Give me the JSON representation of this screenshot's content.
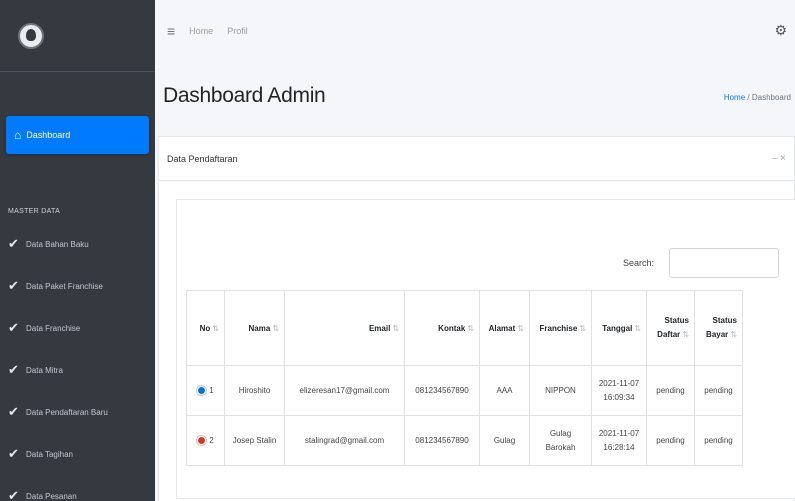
{
  "brand": {
    "line1": "",
    "line2": ""
  },
  "sidebar": {
    "active_item": {
      "label": "Dashboard",
      "icon": "home-icon"
    },
    "section_header": "MASTER DATA",
    "items": [
      {
        "label": "Data Bahan Baku",
        "icon": "check-icon"
      },
      {
        "label": "Data Paket Franchise",
        "icon": "check-icon"
      },
      {
        "label": "Data Franchise",
        "icon": "check-icon"
      },
      {
        "label": "Data Mitra",
        "icon": "check-icon"
      },
      {
        "label": "Data Pendaftaran Baru",
        "icon": "check-icon"
      },
      {
        "label": "Data Tagihan",
        "icon": "check-icon"
      },
      {
        "label": "Data Pesanan",
        "icon": "check-icon"
      }
    ]
  },
  "topbar": {
    "links": [
      "Home",
      "Profil"
    ]
  },
  "page": {
    "title": "Dashboard Admin",
    "breadcrumb": {
      "home": "Home",
      "separator": "/",
      "current": "Dashboard"
    }
  },
  "card": {
    "title": "Data Pendaftaran",
    "tools": "– ×"
  },
  "table": {
    "search_label": "Search:",
    "search_value": "",
    "headers": [
      "No",
      "Nama",
      "Email",
      "Kontak",
      "Alamat",
      "Franchise",
      "Tanggal",
      "Status Daftar",
      "Status Bayar"
    ],
    "rows": [
      {
        "no": "1",
        "nama": "Hiroshito",
        "email": "elizeresan17@gmail.com",
        "kontak": "081234567890",
        "alamat": "AAA",
        "franchise": "NIPPON",
        "tanggal": "2021-11-07 16:09:34",
        "status_daftar": "pending",
        "status_bayar": "pending"
      },
      {
        "no": "2",
        "nama": "Josep Stalin",
        "email": "stalingrad@gmail.com",
        "kontak": "081234567890",
        "alamat": "Gulag",
        "franchise": "Gulag Barokah",
        "tanggal": "2021-11-07 16:28:14",
        "status_daftar": "pending",
        "status_bayar": "pending"
      }
    ]
  },
  "colors": {
    "sidebar": "#343a40",
    "accent": "#007bff",
    "row_expand": "#0275d8",
    "row_collapse": "#d33724"
  }
}
